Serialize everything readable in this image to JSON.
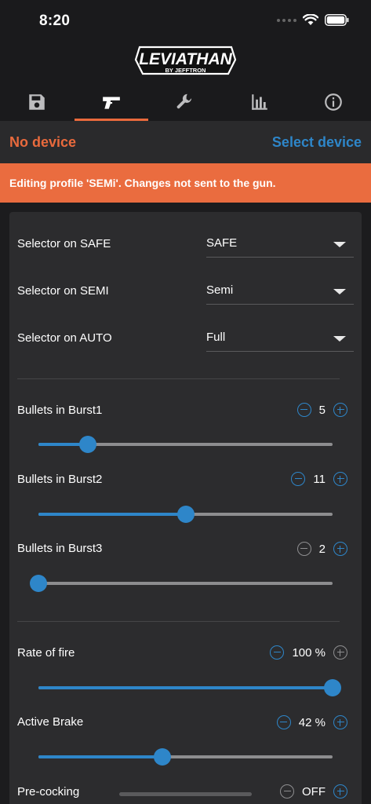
{
  "status_bar": {
    "time": "8:20"
  },
  "header": {
    "logo": "LEVIATHAN",
    "logo_sub": "BY JEFFTRON",
    "tabs": [
      {
        "icon": "save-icon",
        "active": false
      },
      {
        "icon": "gun-icon",
        "active": true
      },
      {
        "icon": "wrench-icon",
        "active": false
      },
      {
        "icon": "bar-chart-icon",
        "active": false
      },
      {
        "icon": "info-icon",
        "active": false
      }
    ]
  },
  "device": {
    "status": "No device",
    "select_label": "Select device"
  },
  "banner": {
    "text": "Editing profile 'SEMi'. Changes not sent to the gun."
  },
  "selectors": [
    {
      "label": "Selector on SAFE",
      "value": "SAFE"
    },
    {
      "label": "Selector on SEMI",
      "value": "Semi"
    },
    {
      "label": "Selector on AUTO",
      "value": "Full"
    }
  ],
  "bursts": [
    {
      "label": "Bullets in Burst1",
      "value": "5",
      "level": 0.167
    },
    {
      "label": "Bullets in Burst2",
      "value": "11",
      "level": 0.5
    },
    {
      "label": "Bullets in Burst3",
      "value": "2",
      "level": 0.0
    }
  ],
  "settings": [
    {
      "label": "Rate of fire",
      "value": "100 %",
      "level": 1.0
    },
    {
      "label": "Active Brake",
      "value": "42 %",
      "level": 0.42
    },
    {
      "label": "Pre-cocking",
      "value": "OFF"
    }
  ],
  "colors": {
    "accent": "#2e86c9",
    "warning": "#ea6c3f",
    "background": "#1c1c1e",
    "card": "#2c2c2e"
  }
}
